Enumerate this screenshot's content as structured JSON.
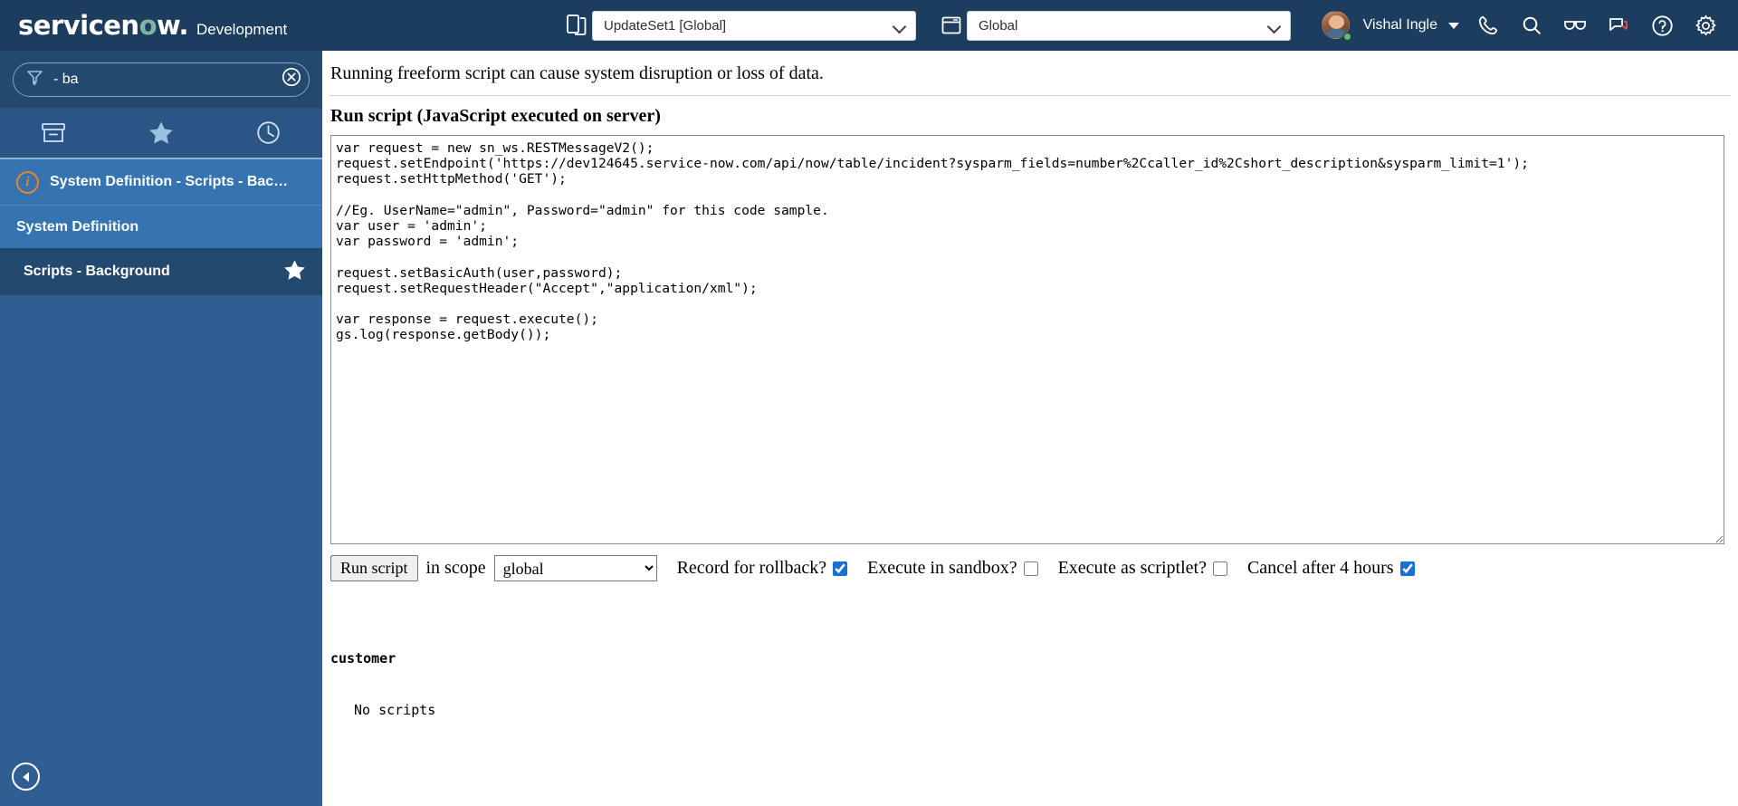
{
  "header": {
    "logo_main": "servicen",
    "logo_accent": "o",
    "logo_tail": "w",
    "logo_dot": ".",
    "environment": "Development",
    "updateset_icon": "update-set-icon",
    "updateset_value": "UpdateSet1 [Global]",
    "scope_icon": "application-scope-icon",
    "scope_value": "Global",
    "user_name": "Vishal Ingle",
    "icons": [
      {
        "name": "phone-icon",
        "title": "Phone"
      },
      {
        "name": "search-icon",
        "title": "Search"
      },
      {
        "name": "impersonate-glasses-icon",
        "title": "Impersonate user"
      },
      {
        "name": "conversations-icon",
        "title": "Conversations"
      },
      {
        "name": "help-icon",
        "title": "Help"
      },
      {
        "name": "gear-icon",
        "title": "System settings"
      }
    ]
  },
  "sidebar": {
    "filter_icon": "filter-funnel-icon",
    "filter_value": "- ba",
    "clear_icon": "clear-circle-x-icon",
    "tabs": [
      {
        "name": "all-applications",
        "icon": "archive-box-icon"
      },
      {
        "name": "favorites",
        "icon": "star-icon"
      },
      {
        "name": "history",
        "icon": "clock-icon"
      }
    ],
    "breadcrumb": "System Definition - Scripts - Bac…",
    "breadcrumb_icon": "info-circle-icon",
    "application": "System Definition",
    "module": "Scripts - Background",
    "module_star_icon": "star-filled-icon",
    "collapse_icon": "collapse-left-icon"
  },
  "main": {
    "warning": "Running freeform script can cause system disruption or loss of data.",
    "section_title": "Run script (JavaScript executed on server)",
    "script": "var request = new sn_ws.RESTMessageV2();\nrequest.setEndpoint('https://dev124645.service-now.com/api/now/table/incident?sysparm_fields=number%2Ccaller_id%2Cshort_description&sysparm_limit=1');\nrequest.setHttpMethod('GET');\n\n//Eg. UserName=\"admin\", Password=\"admin\" for this code sample.\nvar user = 'admin';\nvar password = 'admin';\n\nrequest.setBasicAuth(user,password);\nrequest.setRequestHeader(\"Accept\",\"application/xml\");\n\nvar response = request.execute();\ngs.log(response.getBody());",
    "controls": {
      "run_label": "Run script",
      "in_scope_label": "in scope",
      "scope_value": "global",
      "scope_options": [
        "global"
      ],
      "checkboxes": [
        {
          "name": "record-for-rollback",
          "label": "Record for rollback?",
          "checked": true
        },
        {
          "name": "execute-in-sandbox",
          "label": "Execute in sandbox?",
          "checked": false
        },
        {
          "name": "execute-as-scriptlet",
          "label": "Execute as scriptlet?",
          "checked": false
        },
        {
          "name": "cancel-after-4-hours",
          "label": "Cancel after 4 hours",
          "checked": true
        }
      ]
    },
    "output": {
      "heading": "customer",
      "body": "No scripts"
    }
  }
}
